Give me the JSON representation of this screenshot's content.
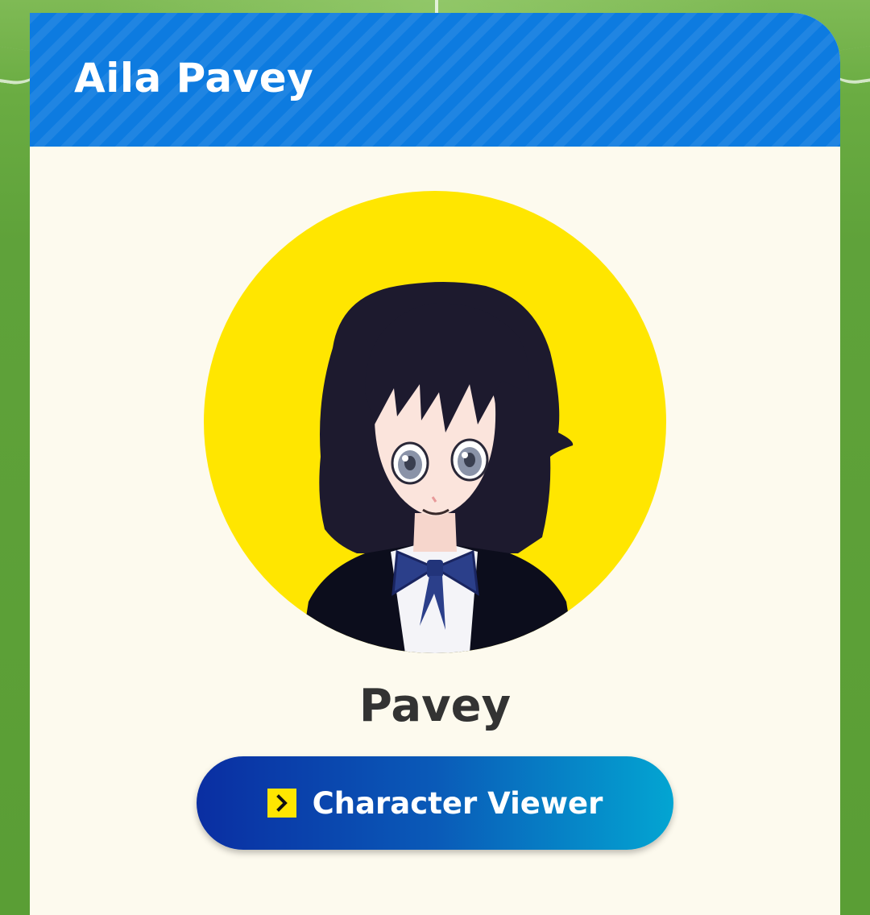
{
  "profile": {
    "title": "Aila Pavey",
    "character_name": "Pavey",
    "viewer_button_label": "Character Viewer",
    "avatar_icon": "character-portrait",
    "button_icon": "chevron-right-icon"
  },
  "colors": {
    "header": "#0d7be0",
    "card": "#fdfaee",
    "portrait_bg": "#ffe600",
    "button_start": "#0a2ea2",
    "button_end": "#03a5d2",
    "field": "#5a9e35"
  }
}
